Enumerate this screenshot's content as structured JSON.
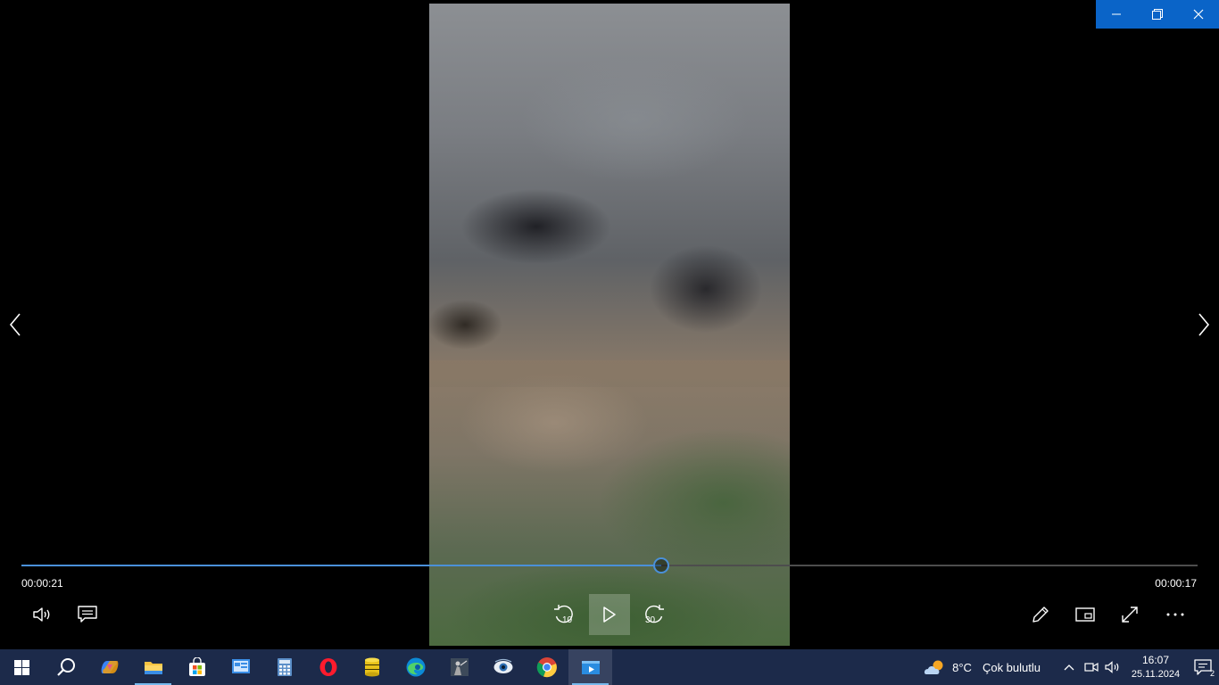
{
  "window": {
    "minimize_label": "Minimize",
    "restore_label": "Restore",
    "close_label": "Close"
  },
  "player": {
    "elapsed": "00:00:21",
    "remaining": "00:00:17",
    "progress_fraction": 0.544,
    "rewind_seconds": "10",
    "forward_seconds": "30"
  },
  "taskbar": {
    "weather_temp": "8°C",
    "weather_desc": "Çok bulutlu",
    "time": "16:07",
    "date": "25.11.2024",
    "notification_count": "2"
  },
  "colors": {
    "accent": "#4a90d9",
    "title_controls": "#0a64c8",
    "taskbar": "#1c2a4a"
  }
}
